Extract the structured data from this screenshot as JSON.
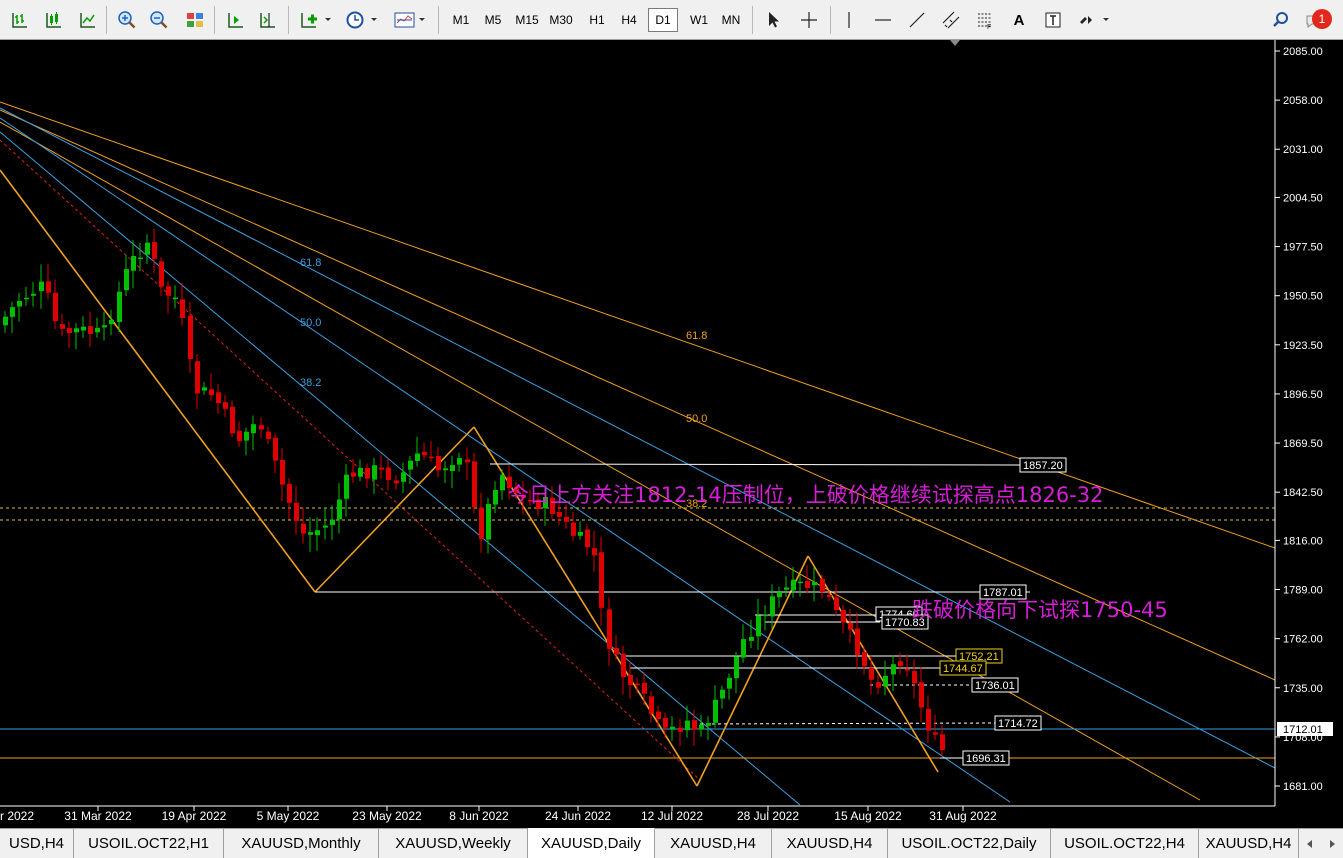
{
  "toolbar": {
    "timeframes": [
      "M1",
      "M5",
      "M15",
      "M30",
      "H1",
      "H4",
      "D1",
      "W1",
      "MN"
    ],
    "active_timeframe": "D1",
    "text_tool_label": "A",
    "notification_count": "1",
    "icons": [
      "bar-chart-icon",
      "candlestick-icon",
      "line-chart-icon",
      "zoom-in-icon",
      "zoom-out-icon",
      "tile-windows-icon",
      "auto-scroll-icon",
      "chart-shift-icon",
      "add-indicator-icon",
      "periods-icon",
      "templates-icon",
      "cursor-icon",
      "crosshair-icon",
      "vertical-line-icon",
      "horizontal-line-icon",
      "trendline-icon",
      "equidistant-channel-icon",
      "fibonacci-icon",
      "text-icon",
      "text-label-icon",
      "arrows-icon",
      "search-icon",
      "notifications-icon"
    ]
  },
  "chart": {
    "price_axis_labels": [
      "2085.00",
      "2058.00",
      "2031.00",
      "2004.50",
      "1977.50",
      "1950.50",
      "1923.50",
      "1896.50",
      "1869.50",
      "1842.50",
      "1816.00",
      "1789.00",
      "1762.00",
      "1735.00",
      "1708.00",
      "1681.00"
    ],
    "current_price": "1712.01",
    "date_axis_labels": [
      "r 2022",
      "31 Mar 2022",
      "19 Apr 2022",
      "5 May 2022",
      "23 May 2022",
      "8 Jun 2022",
      "24 Jun 2022",
      "12 Jul 2022",
      "28 Jul 2022",
      "15 Aug 2022",
      "31 Aug 2022"
    ],
    "fib_labels_blue": [
      "61.8",
      "50.0",
      "38.2"
    ],
    "fib_labels_orange": [
      "61.8",
      "50.0",
      "38.2"
    ],
    "price_tags": [
      {
        "text": "1857.20",
        "style": "white"
      },
      {
        "text": "1787.01",
        "style": "white"
      },
      {
        "text": "1774.69",
        "style": "white"
      },
      {
        "text": "1770.83",
        "style": "white"
      },
      {
        "text": "1752.21",
        "style": "yellow"
      },
      {
        "text": "1744.67",
        "style": "yellow"
      },
      {
        "text": "1736.01",
        "style": "white"
      },
      {
        "text": "1714.72",
        "style": "white"
      },
      {
        "text": "1696.31",
        "style": "white"
      }
    ],
    "annotations": [
      "今日上方关注1812-14压制位，上破价格继续试探高点1826-32",
      "跌破价格向下试探1750-45"
    ],
    "colors": {
      "background": "#000000",
      "bull": "#00c000",
      "bear": "#e00000",
      "fib_orange": "#f0a020",
      "fib_blue": "#3aa0e0",
      "annotation": "#e020e0"
    }
  },
  "tabs": [
    "USD,H4",
    "USOIL.OCT22,H1",
    "XAUUSD,Monthly",
    "XAUUSD,Weekly",
    "XAUUSD,Daily",
    "XAUUSD,H4",
    "XAUUSD,H4",
    "USOIL.OCT22,Daily",
    "USOIL.OCT22,H4",
    "XAUUSD,H4"
  ],
  "active_tab": "XAUUSD,Daily"
}
